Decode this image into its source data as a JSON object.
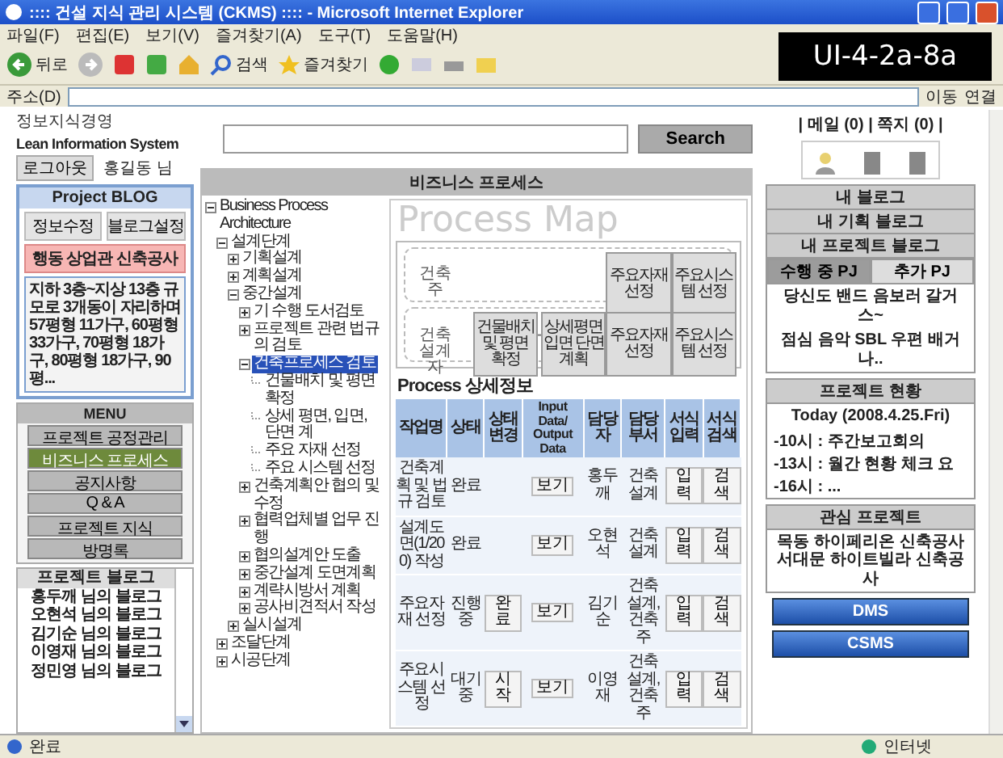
{
  "window": {
    "title": ":::: 건설 지식 관리 시스템 (CKMS) :::: - Microsoft Internet Explorer"
  },
  "menu_bar": [
    "파일(F)",
    "편집(E)",
    "보기(V)",
    "즐겨찾기(A)",
    "도구(T)",
    "도움말(H)"
  ],
  "toolbar": {
    "back": "뒤로",
    "search": "검색",
    "favorites": "즐겨찾기"
  },
  "annotation": "UI-4-2a-8a",
  "address_bar": {
    "label": "주소(D)",
    "go": "이동",
    "links": "연결"
  },
  "header": {
    "tagline": "정보지식경영",
    "logo": "Lean Information System",
    "logout": "로그아웃",
    "user": "홍길동 님",
    "search_button": "Search",
    "mail": "| 메일 (0) | 쪽지 (0) |"
  },
  "blog": {
    "title": "Project BLOG",
    "buttons": [
      "정보수정",
      "블로그설정"
    ],
    "project": "행동 상업관 신축공사",
    "description": "지하 3층~지상 13층 규모로 3개동이 자리하며 57평형 11가구, 60평형 33가구, 70평형 18가구, 80평형 18가구, 90평..."
  },
  "menu": {
    "title": "MENU",
    "items": [
      {
        "label": "프로젝트 공정관리",
        "selected": false
      },
      {
        "label": "비즈니스 프로세스",
        "selected": true
      },
      {
        "label": "공지사항",
        "selected": false
      },
      {
        "label": "Q & A",
        "selected": false
      },
      {
        "label": "프로젝트 지식",
        "selected": false
      },
      {
        "label": "방명록",
        "selected": false
      }
    ]
  },
  "member_blogs": {
    "title": "프로젝트 블로그",
    "items": [
      "홍두깨 님의 블로그",
      "오현석 님의 블로그",
      "김기순 님의 블로그",
      "이영재 님의 블로그",
      "정민영 님의 블로그"
    ]
  },
  "main": {
    "title": "비즈니스 프로세스",
    "tree": [
      {
        "label": "Business Process Architecture",
        "expanded": true,
        "selected": false,
        "children": [
          {
            "label": "설계단계",
            "expanded": true,
            "selected": false,
            "children": [
              {
                "label": "기획설계",
                "expanded": false,
                "selected": false
              },
              {
                "label": "계획설계",
                "expanded": false,
                "selected": false
              },
              {
                "label": "중간설계",
                "expanded": true,
                "selected": false,
                "children": [
                  {
                    "label": "기 수행 도서검토",
                    "expanded": false,
                    "selected": false
                  },
                  {
                    "label": "프로젝트 관련 법규의 검토",
                    "expanded": false,
                    "selected": false
                  },
                  {
                    "label": "건축프로세스 검토",
                    "expanded": true,
                    "selected": true,
                    "children": [
                      {
                        "label": "건물배치 및 평면 확정",
                        "selected": false
                      },
                      {
                        "label": "상세 평면, 입면, 단면 계",
                        "selected": false
                      },
                      {
                        "label": "주요 자재 선정",
                        "selected": false
                      },
                      {
                        "label": "주요 시스템 선정",
                        "selected": false
                      }
                    ]
                  },
                  {
                    "label": "건축계획안 협의 및 수정",
                    "expanded": false,
                    "selected": false
                  },
                  {
                    "label": "협력업체별 업무 진행",
                    "expanded": false,
                    "selected": false
                  },
                  {
                    "label": "협의설계안 도출",
                    "expanded": false,
                    "selected": false
                  },
                  {
                    "label": "중간설계 도면계획",
                    "expanded": false,
                    "selected": false
                  },
                  {
                    "label": "계략시방서 계획",
                    "expanded": false,
                    "selected": false
                  },
                  {
                    "label": "공사비견적서 작성",
                    "expanded": false,
                    "selected": false
                  }
                ]
              },
              {
                "label": "실시설계",
                "expanded": false,
                "selected": false
              }
            ]
          },
          {
            "label": "조달단계",
            "expanded": false,
            "selected": false
          },
          {
            "label": "시공단계",
            "expanded": false,
            "selected": false
          }
        ]
      }
    ],
    "process_map": {
      "title": "Process Map",
      "lanes": [
        {
          "label": "건축주",
          "boxes": [
            "주요자재 선정",
            "주요시스템 선정"
          ]
        },
        {
          "label": "건축 설계자",
          "boxes": [
            "건물배치 및 평면 확정",
            "상세평면 입면 단면 계획",
            "주요자재 선정",
            "주요시스템 선정"
          ]
        }
      ]
    },
    "detail": {
      "title": "Process 상세정보",
      "columns": [
        "작업명",
        "상태",
        "상태 변경",
        "Input Data/ Output Data",
        "담당자",
        "담당 부서",
        "서식 입력",
        "서식 검색"
      ],
      "rows": [
        {
          "task": "건축계획 및 법규 검토",
          "status": "완료",
          "view": "보기",
          "owner": "홍두깨",
          "dept": "건축설계",
          "input": "입력",
          "search": "검색"
        },
        {
          "task": "설계도면(1/200) 작성",
          "status": "완료",
          "view": "보기",
          "owner": "오현석",
          "dept": "건축설계",
          "input": "입력",
          "search": "검색"
        },
        {
          "task": "주요자재 선정",
          "status": "진행중",
          "change": "완료",
          "view": "보기",
          "owner": "김기순",
          "dept": "건축설계, 건축주",
          "input": "입력",
          "search": "검색"
        },
        {
          "task": "주요시스템 선정",
          "status": "대기중",
          "change": "시작",
          "view": "보기",
          "owner": "이영재",
          "dept": "건축설계, 건축주",
          "input": "입력",
          "search": "검색"
        }
      ]
    }
  },
  "right": {
    "blog_tabs": [
      "내 블로그",
      "내 기획 블로그",
      "내 프로젝트 블로그"
    ],
    "pj_tabs": [
      {
        "label": "수행 중 PJ",
        "selected": true
      },
      {
        "label": "추가 PJ",
        "selected": false
      }
    ],
    "pj_text": [
      "당신도 밴드 음보러 갈거 스~",
      "점심 음악 SBL 우편 배거 나.."
    ],
    "status": {
      "title": "프로젝트 현황",
      "today": "Today (2008.4.25.Fri)",
      "items": [
        "-10시 : 주간보고회의",
        "-13시 : 월간 현황 체크 요",
        "-16시 : ..."
      ]
    },
    "interest": {
      "title": "관심 프로젝트",
      "text": "목동 하이페리온 신축공사 서대문 하이트빌라 신축공사"
    },
    "buttons": [
      "DMS",
      "CSMS"
    ]
  },
  "status_bar": {
    "text": "완료",
    "zone": "인터넷"
  }
}
